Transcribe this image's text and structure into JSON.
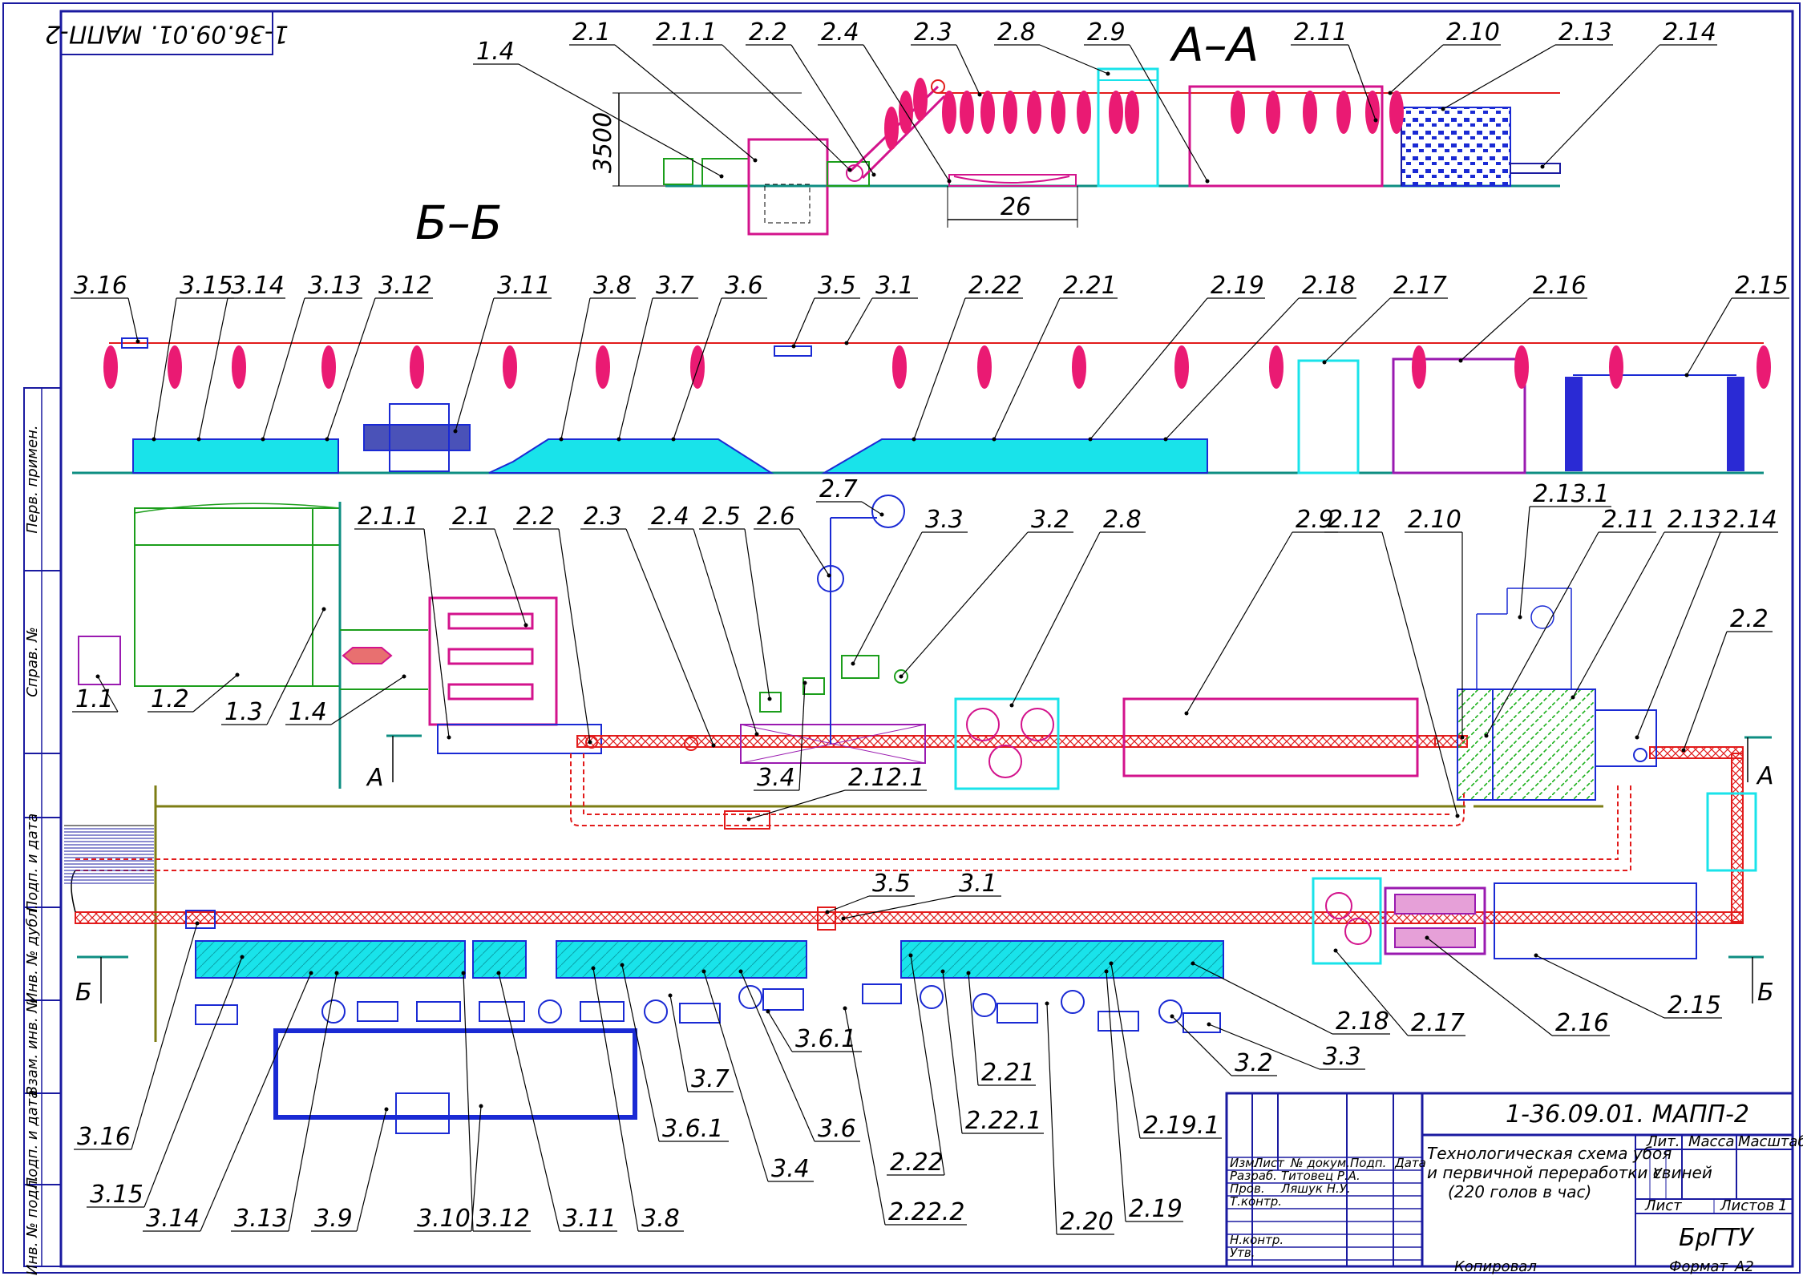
{
  "drawing_id_top": "1-36.09.01. МАПП-2",
  "section_aa": "А–А",
  "section_bb": "Б–Б",
  "dim_height": "3500",
  "dim_length": "26",
  "cut_a": "А",
  "cut_b": "Б",
  "section_aa_labels": [
    "1.4",
    "2.1",
    "2.1.1",
    "2.2",
    "2.4",
    "2.3",
    "2.8",
    "2.9",
    "2.11",
    "2.10",
    "2.13",
    "2.14"
  ],
  "section_bb_labels": [
    "3.16",
    "3.15",
    "3.14",
    "3.13",
    "3.12",
    "3.11",
    "3.8",
    "3.7",
    "3.6",
    "3.5",
    "3.1",
    "2.22",
    "2.21",
    "2.19",
    "2.18",
    "2.17",
    "2.16",
    "2.15"
  ],
  "plan_labels": [
    "1.1",
    "1.2",
    "1.3",
    "1.4",
    "2.1.1",
    "2.1",
    "2.2",
    "2.3",
    "2.4",
    "2.5",
    "2.6",
    "2.7",
    "3.3",
    "3.2",
    "2.8",
    "2.9",
    "2.12",
    "2.10",
    "2.13.1",
    "2.11",
    "2.13",
    "2.14",
    "2.2",
    "3.4",
    "2.12.1",
    "3.5",
    "3.1",
    "3.6.1",
    "3.7",
    "3.6",
    "3.4",
    "2.22",
    "2.22.1",
    "2.22.2",
    "2.21",
    "2.20",
    "2.19",
    "2.19.1",
    "3.2",
    "3.3",
    "2.18",
    "2.17",
    "2.16",
    "2.15",
    "3.16",
    "3.15",
    "3.14",
    "3.13",
    "3.9",
    "3.10",
    "3.12",
    "3.11",
    "3.8",
    "3.6.1"
  ],
  "side_stamp": [
    "Перв. примен.",
    "Справ. №",
    "Подп. и дата",
    "Инв. № дубл.",
    "Взам. инв. №",
    "Подп. и дата",
    "Инв. № подл."
  ],
  "title_block": {
    "code": "1-36.09.01. МАПП-2",
    "title_lines": [
      "Технологическая схема убоя",
      "и первичной переработки свиней",
      "(220 голов в час)"
    ],
    "col_heads": [
      "Изм.",
      "Лист",
      "№ докум.",
      "Подп.",
      "Дата"
    ],
    "rows": [
      {
        "role": "Разраб.",
        "name": "Титовец Р.А."
      },
      {
        "role": "Пров.",
        "name": "Ляшук Н.У."
      },
      {
        "role": "Т.контр.",
        "name": ""
      },
      {
        "role": "",
        "name": ""
      },
      {
        "role": "Н.контр.",
        "name": ""
      },
      {
        "role": "Утв.",
        "name": ""
      }
    ],
    "lit": "Лит.",
    "mass": "Масса",
    "scale": "Масштаб",
    "lit_value": "У",
    "sheet": "Лист",
    "sheets": "Листов",
    "sheets_value": "1",
    "org": "БрГТУ",
    "copied": "Копировал",
    "format_label": "Формат",
    "format_value": "А2"
  },
  "colors": {
    "frame": "#1a1aa0",
    "conveyor": "#e21b1b",
    "carcass": "#ea1a73",
    "equip_cyan": "#19e3ea",
    "equip_magenta": "#d3138c",
    "green": "#1b9e1b",
    "olive": "#7d7d14",
    "teal": "#0e8e82",
    "blue": "#1a2ad4"
  }
}
